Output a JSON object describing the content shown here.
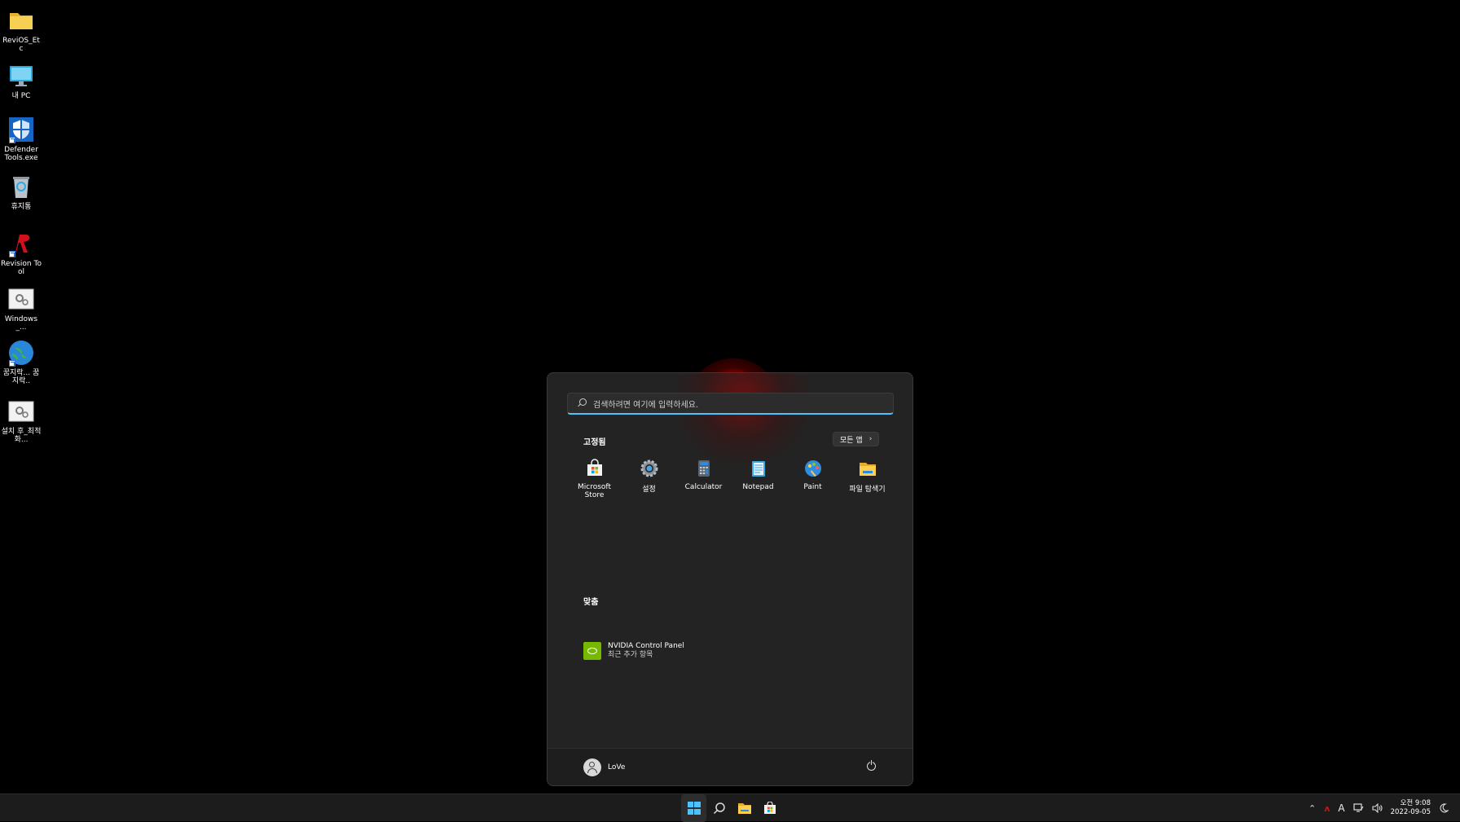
{
  "desktop": {
    "icons": [
      {
        "label": "ReviOS_Etc",
        "icon": "folder-icon"
      },
      {
        "label": "내 PC",
        "icon": "monitor-icon"
      },
      {
        "label": "Defender Tools.exe",
        "icon": "shield-icon"
      },
      {
        "label": "휴지통",
        "icon": "recycle-bin-icon"
      },
      {
        "label": "Revision Tool",
        "icon": "revision-r-icon"
      },
      {
        "label": "Windows_...",
        "icon": "settings-file-icon"
      },
      {
        "label": "꿈지락... 꿈지락..",
        "icon": "globe-icon"
      },
      {
        "label": "설치 후_최적화...",
        "icon": "settings-file-icon"
      }
    ]
  },
  "start_menu": {
    "search_placeholder": "검색하려면 여기에 입력하세요.",
    "pinned_title": "고정됨",
    "all_apps_label": "모든 앱",
    "pinned_apps": [
      {
        "label": "Microsoft Store",
        "icon": "store-icon"
      },
      {
        "label": "설정",
        "icon": "gear-icon"
      },
      {
        "label": "Calculator",
        "icon": "calculator-icon"
      },
      {
        "label": "Notepad",
        "icon": "notepad-icon"
      },
      {
        "label": "Paint",
        "icon": "paint-icon"
      },
      {
        "label": "파일 탐색기",
        "icon": "folder-icon"
      }
    ],
    "recommended_title": "맞춤",
    "recommended": [
      {
        "title": "NVIDIA Control Panel",
        "subtitle": "최근 추가 항목",
        "icon": "nvidia-icon"
      }
    ],
    "user_name": "LoVe"
  },
  "taskbar": {
    "buttons": [
      "start-icon",
      "search-icon",
      "file-explorer-icon",
      "store-icon"
    ],
    "tray": {
      "input_indicator": "A",
      "time": "오전 9:08",
      "date": "2022-09-05"
    }
  },
  "colors": {
    "accent": "#4cc2ff",
    "menu_bg": "#242424",
    "nvidia": "#76b900"
  }
}
